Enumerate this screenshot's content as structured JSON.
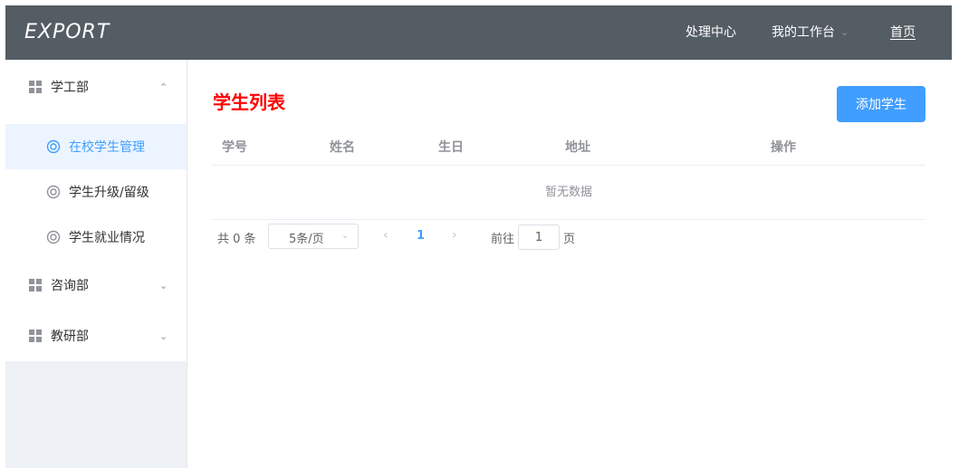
{
  "header": {
    "logo": "EXPORT",
    "nav": {
      "processing_center": "处理中心",
      "my_workbench": "我的工作台",
      "home": "首页"
    }
  },
  "sidebar": {
    "groups": [
      {
        "label": "学工部",
        "expanded": true,
        "items": [
          {
            "label": "在校学生管理",
            "active": true
          },
          {
            "label": "学生升级/留级",
            "active": false
          },
          {
            "label": "学生就业情况",
            "active": false
          }
        ]
      },
      {
        "label": "咨询部",
        "expanded": false
      },
      {
        "label": "教研部",
        "expanded": false
      }
    ]
  },
  "main": {
    "title": "学生列表",
    "add_button": "添加学生",
    "table": {
      "columns": [
        "学号",
        "姓名",
        "生日",
        "地址",
        "操作"
      ],
      "rows": [],
      "empty_text": "暂无数据"
    },
    "pagination": {
      "total": "共 0 条",
      "page_size": "5条/页",
      "current_page": "1",
      "goto_label": "前往",
      "goto_value": "1",
      "page_unit": "页"
    }
  },
  "colors": {
    "header_bg": "#545c64",
    "accent": "#409eff",
    "title": "#ff0000",
    "active_item_bg": "#ecf5ff"
  },
  "icons": {
    "group": "grid-icon",
    "item": "lifebuoy-icon",
    "expanded": "chevron-up-icon",
    "collapsed": "chevron-down-icon"
  }
}
